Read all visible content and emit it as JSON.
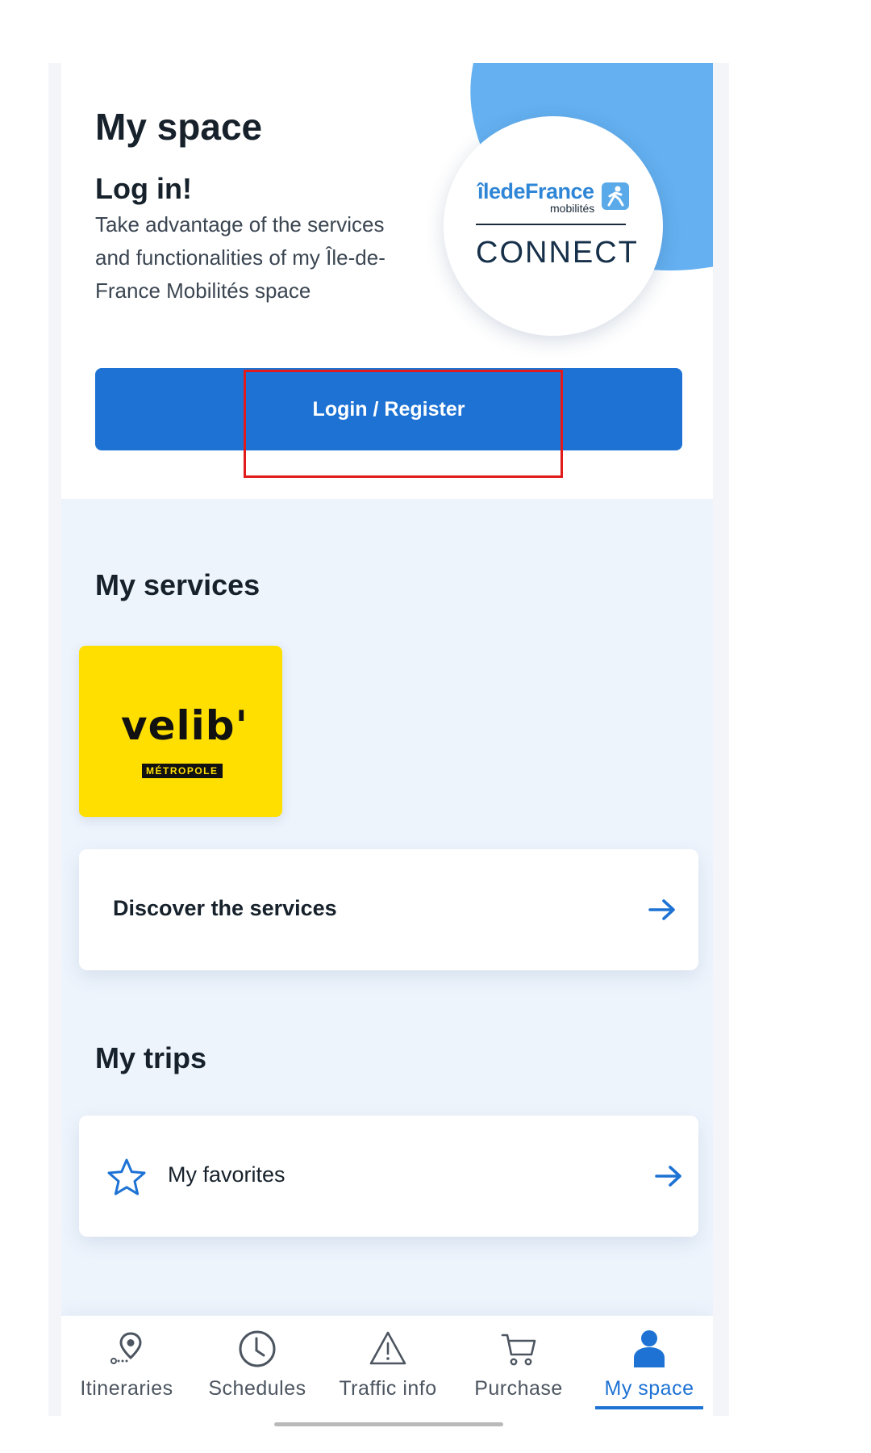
{
  "header": {
    "title": "My space",
    "login_heading": "Log in!",
    "login_description": "Take advantage of the services and functionalities of my Île-de-France Mobilités space",
    "login_button_label": "Login / Register",
    "logo": {
      "brand_text": "îledeFrance",
      "brand_sub": "mobilités",
      "connect_text": "CONNECT"
    }
  },
  "services": {
    "title": "My services",
    "velib": {
      "wordmark": "velib'",
      "subtitle": "MÉTROPOLE"
    },
    "discover_label": "Discover the services"
  },
  "trips": {
    "title": "My trips",
    "favorites_label": "My favorites"
  },
  "nav": {
    "items": [
      {
        "label": "Itineraries",
        "icon": "map-pin-icon",
        "active": false
      },
      {
        "label": "Schedules",
        "icon": "clock-icon",
        "active": false
      },
      {
        "label": "Traffic info",
        "icon": "warning-icon",
        "active": false
      },
      {
        "label": "Purchase",
        "icon": "cart-icon",
        "active": false
      },
      {
        "label": "My space",
        "icon": "user-icon",
        "active": true
      }
    ]
  },
  "colors": {
    "accent": "#1d72d4",
    "blob": "#64b0f0",
    "velib_yellow": "#ffdf00",
    "highlight_red": "#e11b1b",
    "background": "#eef4fc"
  }
}
